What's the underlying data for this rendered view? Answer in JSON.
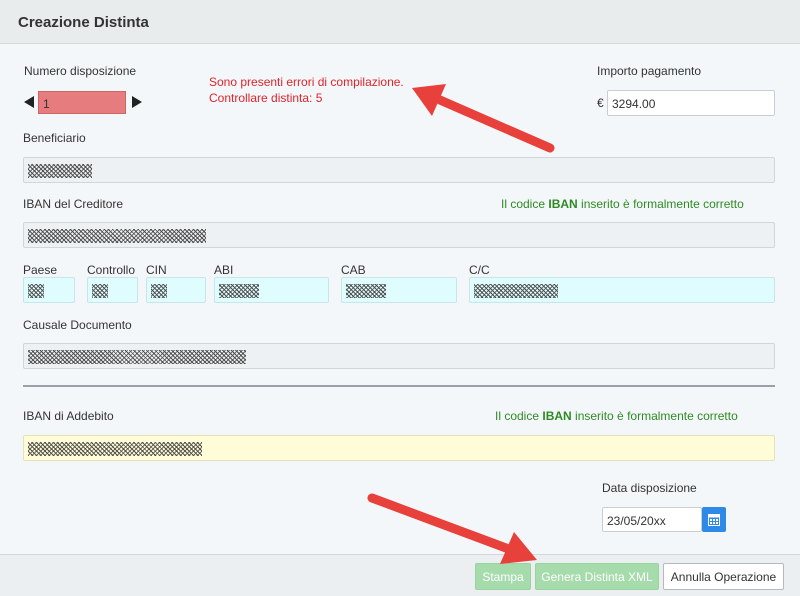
{
  "header": {
    "title": "Creazione Distinta"
  },
  "numero": {
    "label": "Numero disposizione",
    "value": "1"
  },
  "errors": {
    "line1": "Sono presenti errori di compilazione.",
    "line2": "Controllare distinta: 5"
  },
  "importo": {
    "label": "Importo pagamento",
    "currency": "€",
    "value": "3294.00"
  },
  "beneficiario": {
    "label": "Beneficiario"
  },
  "iban_creditore": {
    "label": "IBAN del Creditore",
    "status_pre": "Il codice ",
    "status_bold": "IBAN",
    "status_post": " inserito è formalmente corretto"
  },
  "iban_parts": {
    "paese": "Paese",
    "controllo": "Controllo",
    "cin": "CIN",
    "abi": "ABI",
    "cab": "CAB",
    "cc": "C/C"
  },
  "causale": {
    "label": "Causale Documento"
  },
  "iban_addebito": {
    "label": "IBAN di Addebito",
    "status_pre": "Il codice ",
    "status_bold": "IBAN",
    "status_post": " inserito è formalmente corretto"
  },
  "data_disposizione": {
    "label": "Data disposizione",
    "value": "23/05/20xx"
  },
  "footer": {
    "stampa": "Stampa",
    "genera": "Genera Distinta XML",
    "annulla": "Annulla Operazione"
  },
  "colors": {
    "error": "#e0242b",
    "ok": "#2f8a24",
    "accent": "#2e8ae6",
    "annotation_arrow": "#e8403a"
  },
  "icons": {
    "prev": "triangle-left-icon",
    "next": "triangle-right-icon",
    "calendar": "calendar-icon"
  }
}
